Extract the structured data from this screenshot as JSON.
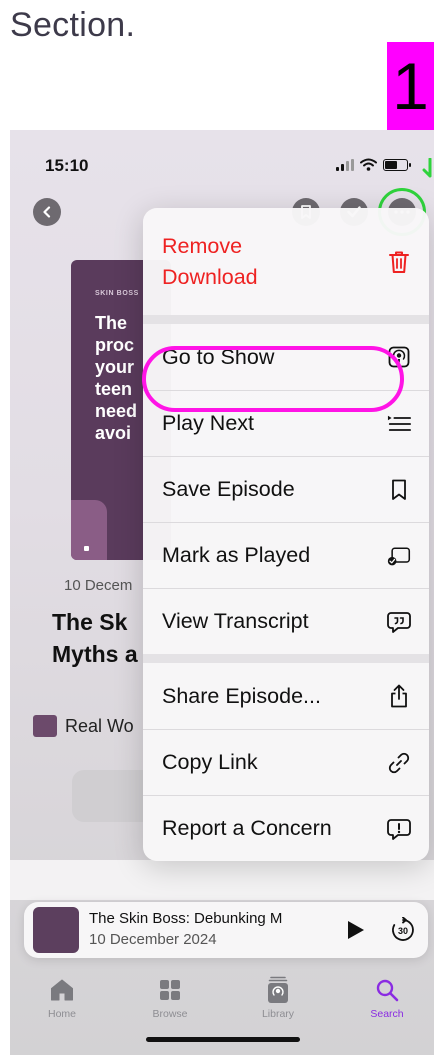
{
  "heading": "Section.",
  "step_badge": "1",
  "status": {
    "time": "15:10"
  },
  "artwork": {
    "show_label": "SKIN BOSS",
    "text_lines": "The\nproc\nyour\nteen\nneed\navoi"
  },
  "episode": {
    "date": "10 Decem",
    "title": "The Sk\nMyths a",
    "show_name": "Real Wo"
  },
  "menu": {
    "items": [
      {
        "label": "Remove\nDownload"
      },
      {
        "label": "Go to Show"
      },
      {
        "label": "Play Next"
      },
      {
        "label": "Save Episode"
      },
      {
        "label": "Mark as Played"
      },
      {
        "label": "View Transcript"
      },
      {
        "label": "Share Episode..."
      },
      {
        "label": "Copy Link"
      },
      {
        "label": "Report a Concern"
      }
    ]
  },
  "mini_player": {
    "title": "The Skin Boss: Debunking M",
    "subtitle": "10 December 2024",
    "skip_label": "30"
  },
  "tabs": [
    {
      "label": "Home"
    },
    {
      "label": "Browse"
    },
    {
      "label": "Library"
    },
    {
      "label": "Search"
    }
  ],
  "colors": {
    "highlight": "#ff14e6",
    "badge": "#ff00ff",
    "green_marker": "#2fd33c",
    "danger": "#ee2222",
    "accent": "#8a2be2"
  }
}
